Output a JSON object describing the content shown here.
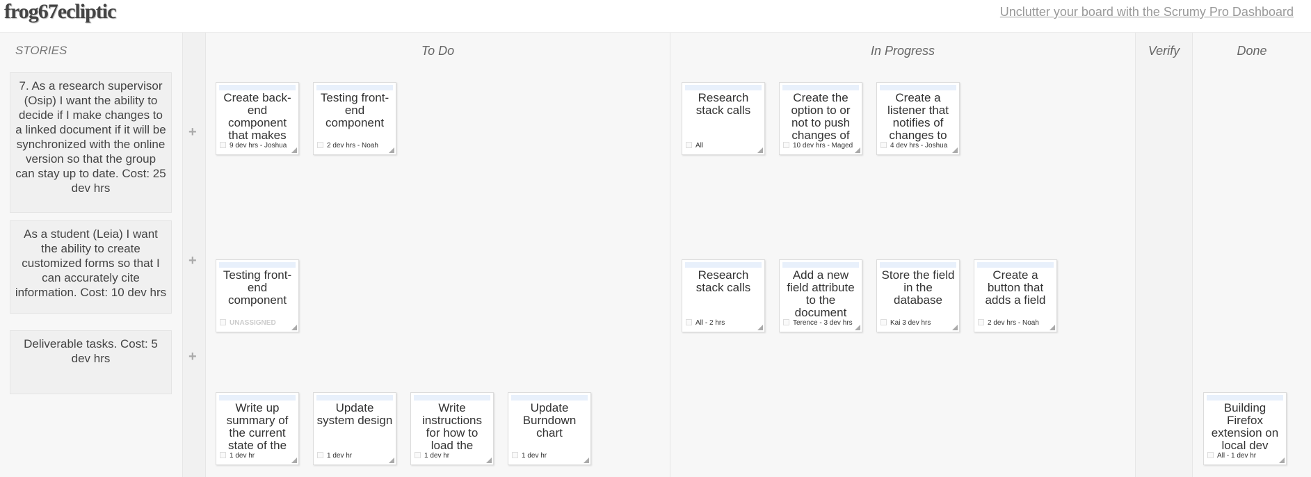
{
  "header": {
    "board_name": "frog67ecliptic",
    "promo_link": "Unclutter your board with the Scrumy Pro Dashboard"
  },
  "columns": {
    "stories": "STORIES",
    "todo": "To Do",
    "in_progress": "In Progress",
    "verify": "Verify",
    "done": "Done"
  },
  "add_task_symbol": "+",
  "stories": [
    {
      "text": "7. As a research supervisor (Osip) I want the ability to decide if I make changes to a linked document if it will be synchronized with the online version so that the group can stay up to date. Cost: 25 dev hrs",
      "todo": [
        {
          "title": "Create back-end component that makes",
          "assignee": "9 dev hrs - Joshua"
        },
        {
          "title": "Testing front-end component",
          "assignee": "2 dev hrs - Noah"
        }
      ],
      "in_progress": [
        {
          "title": "Research stack calls",
          "assignee": "All"
        },
        {
          "title": "Create the option to or not to push changes of",
          "assignee": "10 dev hrs - Maged"
        },
        {
          "title": "Create a listener that notifies of changes to",
          "assignee": "4 dev hrs - Joshua"
        }
      ],
      "done": []
    },
    {
      "text": "As a student (Leia) I want the ability to create customized forms so that I can accurately cite information. Cost: 10 dev hrs",
      "todo": [
        {
          "title": "Testing front-end component",
          "assignee": "UNASSIGNED"
        }
      ],
      "in_progress": [
        {
          "title": "Research stack calls",
          "assignee": "All - 2 hrs"
        },
        {
          "title": "Add a new field attribute to the document",
          "assignee": "Terence - 3 dev hrs"
        },
        {
          "title": "Store the field in the database",
          "assignee": "Kai 3 dev hrs"
        },
        {
          "title": "Create a button that adds a field",
          "assignee": "2 dev hrs - Noah"
        }
      ],
      "done": []
    },
    {
      "text": "Deliverable tasks. Cost: 5 dev hrs",
      "todo": [
        {
          "title": "Write up summary of the current state of the",
          "assignee": "1 dev hr"
        },
        {
          "title": "Update system design",
          "assignee": "1 dev hr"
        },
        {
          "title": "Write instructions for how to load the project",
          "assignee": "1 dev hr"
        },
        {
          "title": "Update Burndown chart",
          "assignee": "1 dev hr"
        }
      ],
      "in_progress": [],
      "done": [
        {
          "title": "Building Firefox extension on local dev",
          "assignee": "All - 1 dev hr"
        }
      ]
    }
  ]
}
